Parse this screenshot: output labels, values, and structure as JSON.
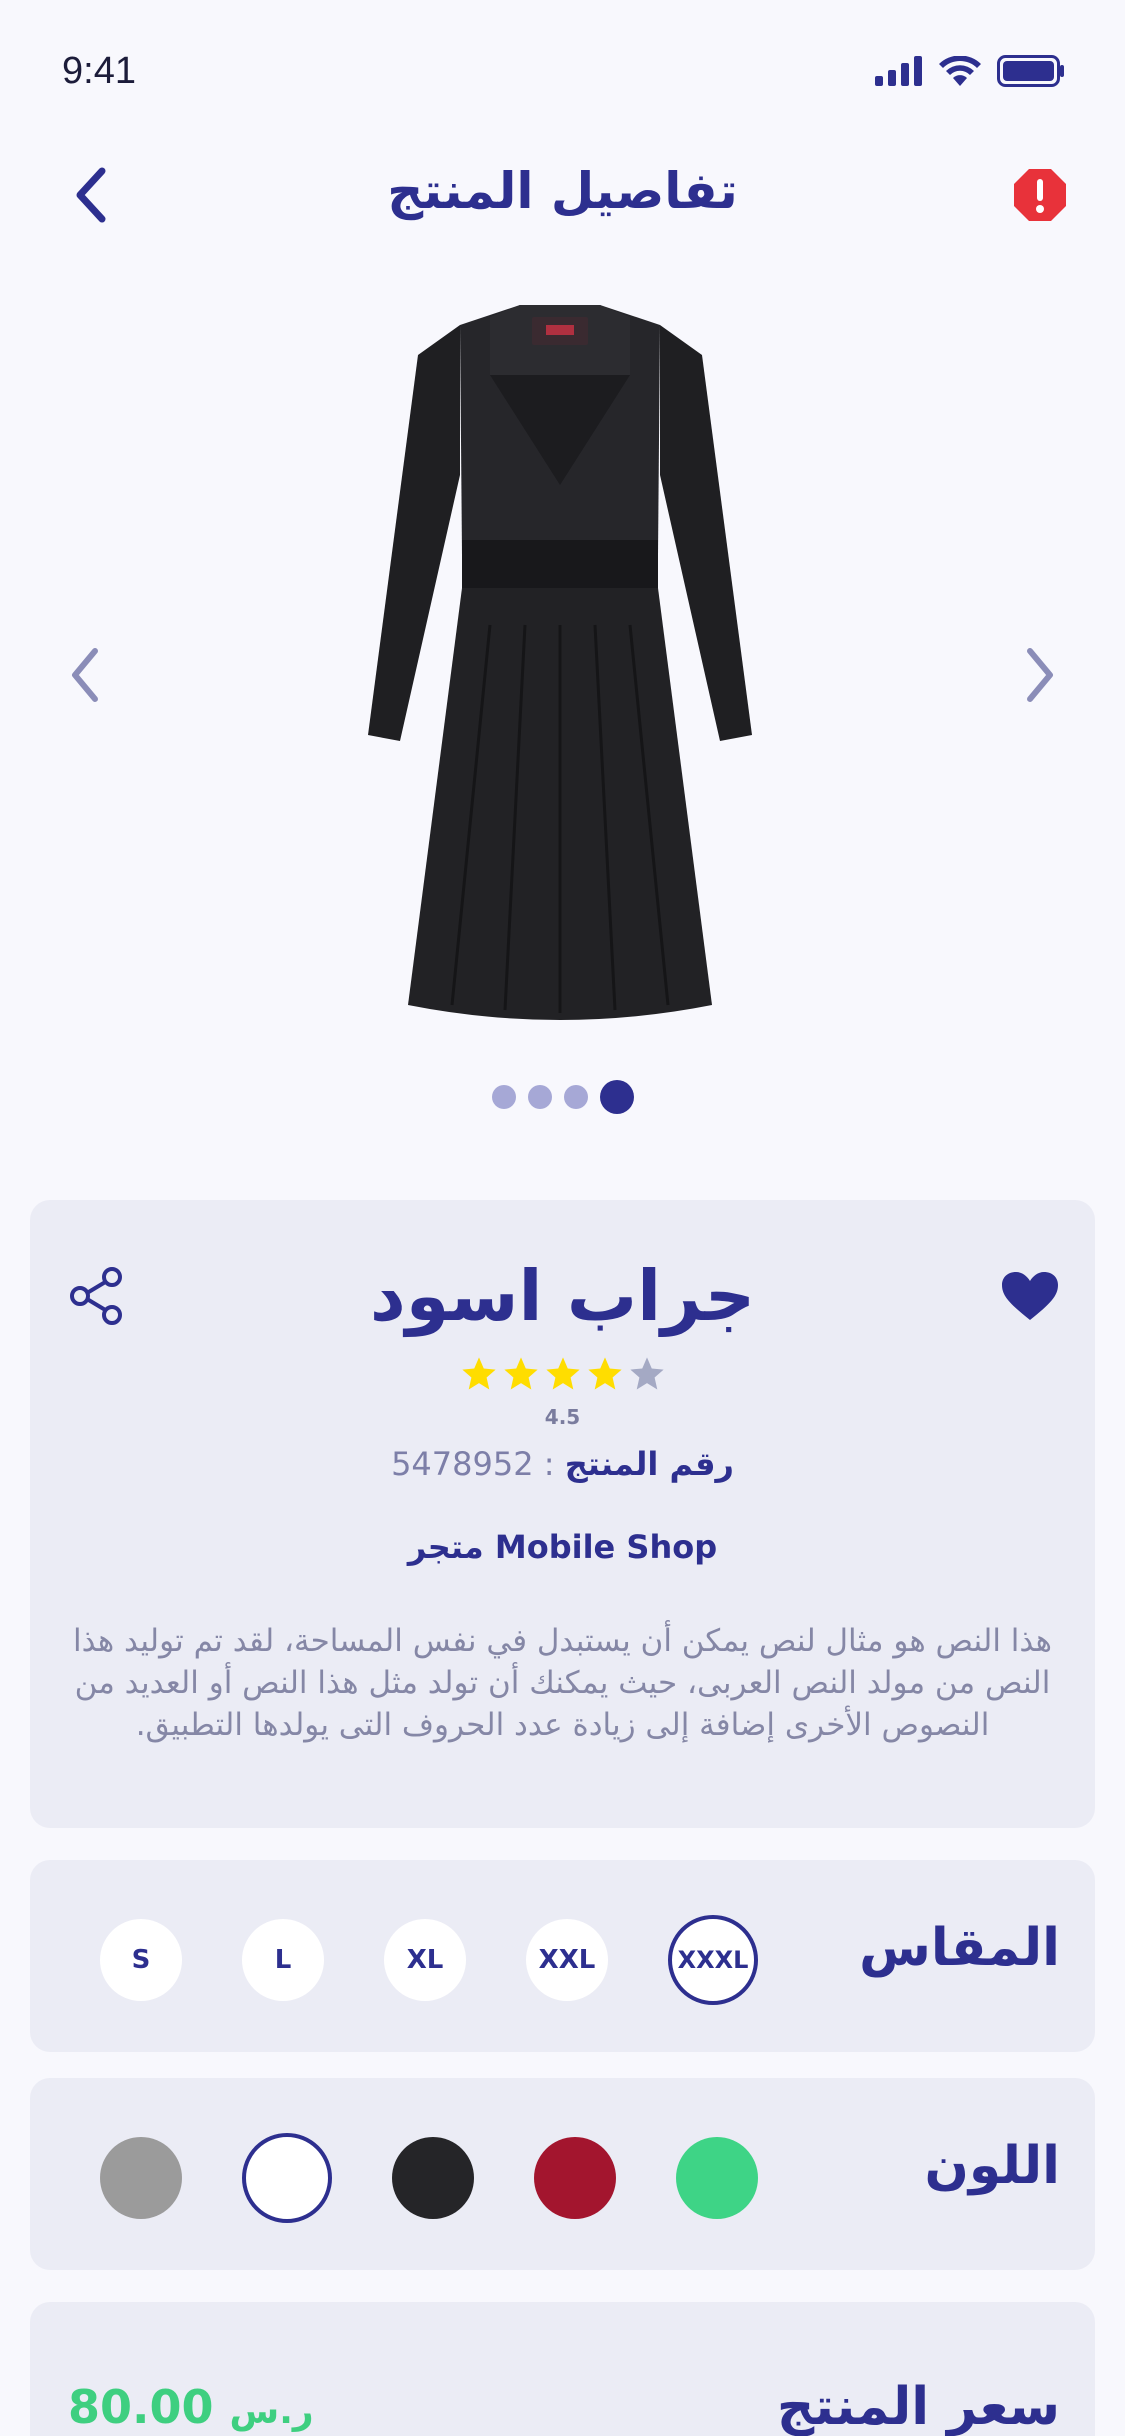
{
  "status": {
    "time": "9:41"
  },
  "header": {
    "title": "تفاصيل المنتج"
  },
  "gallery": {
    "image_count": 4,
    "active_index": 3
  },
  "product": {
    "name": "جراب اسود",
    "rating": "4.5",
    "stars_filled": 4,
    "stars_total": 5,
    "id_label": "رقم المنتج",
    "id_sep": ":",
    "id_value": "5478952",
    "store": "متجر Mobile Shop",
    "description": "هذا النص هو مثال لنص يمكن أن يستبدل في نفس المساحة، لقد تم توليد هذا النص من مولد النص العربى، حيث يمكنك أن تولد مثل هذا النص أو العديد من النصوص الأخرى إضافة إلى زيادة عدد الحروف التى يولدها التطبيق."
  },
  "sizes": {
    "label": "المقاس",
    "options": [
      "S",
      "L",
      "XL",
      "XXL",
      "XXXL"
    ],
    "selected": "XXXL"
  },
  "colors": {
    "label": "اللون",
    "options": [
      "#9b9b9b",
      "#ffffff",
      "#252528",
      "#a3152e",
      "#3ed486"
    ],
    "selected_index": 1
  },
  "price": {
    "label": "سعر المنتج",
    "currency": "ر.س",
    "value": "80.00"
  },
  "theme": {
    "primary": "#2d2f8f",
    "star": "#ffdd00",
    "alert": "#e8323a",
    "price": "#3ecf80"
  }
}
